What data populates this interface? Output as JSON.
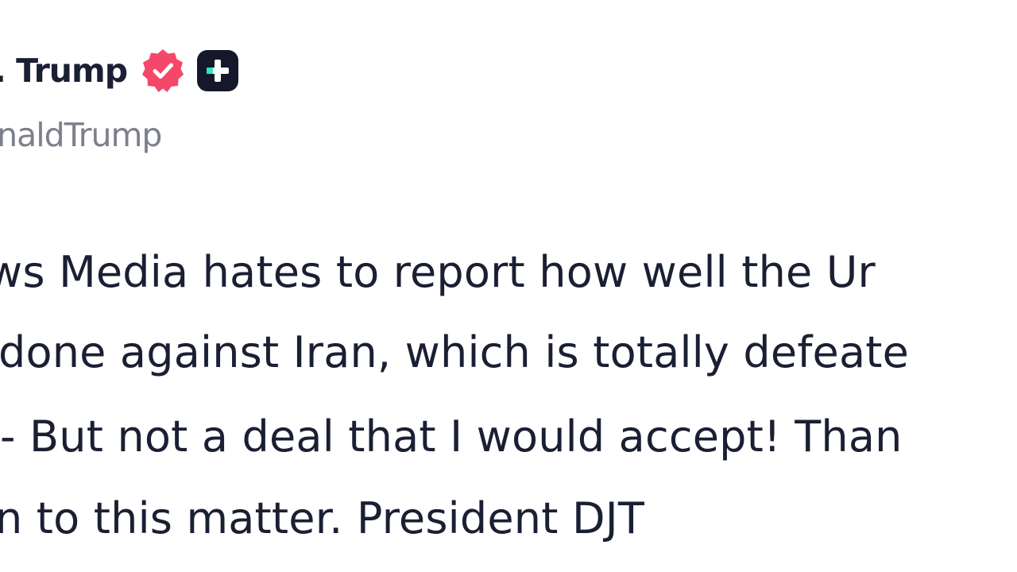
{
  "author": {
    "display_name": "J. Trump",
    "handle": "onaldTrump",
    "verified_icon": "verified-check-badge",
    "verified_color": "#f5476a",
    "plus_icon": "plus-badge",
    "plus_color": "#15182a"
  },
  "post": {
    "lines": [
      "ws Media hates to report how well the Ur",
      "done against Iran, which is totally defeate",
      " - But not a deal that I would accept! Than",
      "n to this matter. President DJT"
    ]
  }
}
